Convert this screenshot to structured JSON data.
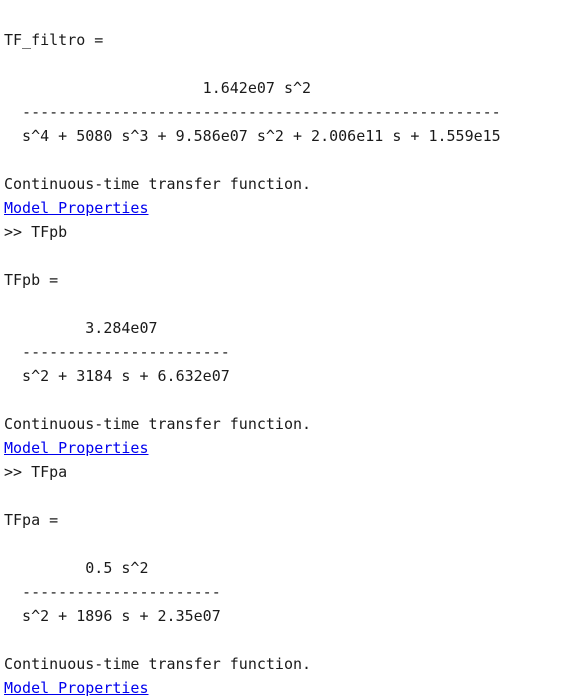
{
  "console": {
    "lines": [
      {
        "type": "text",
        "text": "TF_filtro ="
      },
      {
        "type": "blank",
        "text": ""
      },
      {
        "type": "text",
        "text": "                      1.642e07 s^2"
      },
      {
        "type": "text",
        "text": "  -----------------------------------------------------"
      },
      {
        "type": "text",
        "text": "  s^4 + 5080 s^3 + 9.586e07 s^2 + 2.006e11 s + 1.559e15"
      },
      {
        "type": "blank",
        "text": ""
      },
      {
        "type": "text",
        "text": "Continuous-time transfer function."
      },
      {
        "type": "link",
        "text": "Model Properties"
      },
      {
        "type": "prompt",
        "text": ">> TFpb"
      },
      {
        "type": "blank",
        "text": ""
      },
      {
        "type": "text",
        "text": "TFpb ="
      },
      {
        "type": "blank",
        "text": ""
      },
      {
        "type": "text",
        "text": "         3.284e07"
      },
      {
        "type": "text",
        "text": "  -----------------------"
      },
      {
        "type": "text",
        "text": "  s^2 + 3184 s + 6.632e07"
      },
      {
        "type": "blank",
        "text": ""
      },
      {
        "type": "text",
        "text": "Continuous-time transfer function."
      },
      {
        "type": "link",
        "text": "Model Properties"
      },
      {
        "type": "prompt",
        "text": ">> TFpa"
      },
      {
        "type": "blank",
        "text": ""
      },
      {
        "type": "text",
        "text": "TFpa ="
      },
      {
        "type": "blank",
        "text": ""
      },
      {
        "type": "text",
        "text": "         0.5 s^2"
      },
      {
        "type": "text",
        "text": "  ----------------------"
      },
      {
        "type": "text",
        "text": "  s^2 + 1896 s + 2.35e07"
      },
      {
        "type": "blank",
        "text": ""
      },
      {
        "type": "text",
        "text": "Continuous-time transfer function."
      },
      {
        "type": "link",
        "text": "Model Properties"
      }
    ]
  },
  "colors": {
    "text": "#1a1a1a",
    "link": "#0000ee",
    "background": "#ffffff"
  }
}
